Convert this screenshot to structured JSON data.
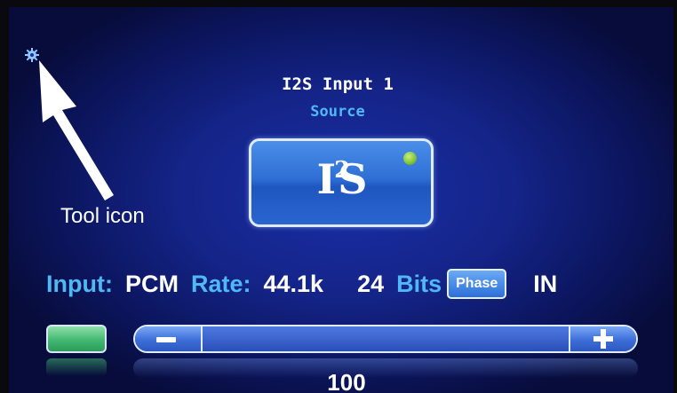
{
  "header": {
    "input_name": "I2S Input 1",
    "section_label": "Source"
  },
  "source_button": {
    "glyph_main": "I",
    "glyph_sup": "2",
    "glyph_tail": "S",
    "led_color": "#8fd04a",
    "led_on": true
  },
  "annotation": {
    "label": "Tool icon"
  },
  "status": {
    "input_label": "Input:",
    "input_value": "PCM",
    "rate_label": "Rate:",
    "rate_value": "44.1k",
    "bits_value": "24",
    "bits_label": "Bits",
    "phase_button_label": "Phase",
    "phase_value": "IN"
  },
  "volume": {
    "value": "100",
    "level": 1.0
  },
  "colors": {
    "accent": "#4fb8f5",
    "screen_bg": "#142488",
    "mute_green": "#43b872"
  }
}
